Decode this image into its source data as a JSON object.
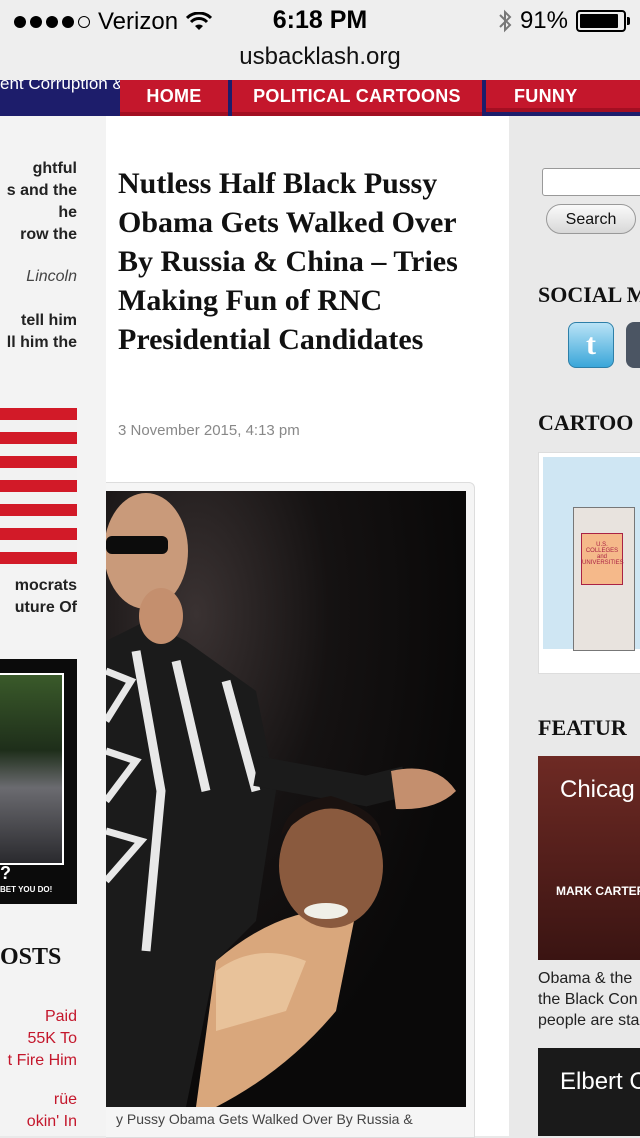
{
  "status_bar": {
    "carrier": "Verizon",
    "time": "6:18 PM",
    "battery_percent": "91%",
    "battery_level": 0.91
  },
  "browser": {
    "url": "usbacklash.org"
  },
  "site_nav": {
    "ticker_text": "ent Corruption &",
    "tabs": [
      "HOME",
      "POLITICAL CARTOONS",
      "FUNNY PHOTO"
    ],
    "accent_color": "#c4172c",
    "banner_color": "#1d1d6b"
  },
  "left_sidebar": {
    "snippet_lines": [
      "ghtful",
      "s and the",
      "he",
      "row the"
    ],
    "quote_author": "Lincoln",
    "snippet2_lines": [
      "tell him",
      "ll him the"
    ],
    "flag_caption_lines": [
      "mocrats",
      "uture Of"
    ],
    "poster_question": "?",
    "poster_tagline": "BET YOU DO!",
    "posts_heading": "OSTS",
    "post_links": [
      [
        "Paid",
        "55K To",
        "t Fire Him"
      ],
      [
        "rüe",
        "okin' In"
      ]
    ]
  },
  "article": {
    "title": "Nutless Half Black Pussy Obama Gets Walked Over By Russia & China – Tries Making Fun of RNC Presidential Candidates",
    "date": "3 November 2015, 4:13 pm",
    "image_caption": "y Pussy Obama Gets Walked Over By Russia &"
  },
  "right_sidebar": {
    "search_button": "Search",
    "social_heading": "SOCIAL M",
    "twitter_icon_letter": "t",
    "cartoons_heading": "CARTOO",
    "cartoon_sign_text": "U.S. COLLEGES and UNIVERSITIES",
    "featured_heading": "FEATUR",
    "featured_items": [
      {
        "image_label": "Chicag",
        "image_sublabel": "MARK CARTER",
        "text_lines": [
          "Obama & the",
          "the Black Con",
          "people are sta"
        ]
      },
      {
        "image_label": "Elbert C"
      }
    ]
  }
}
